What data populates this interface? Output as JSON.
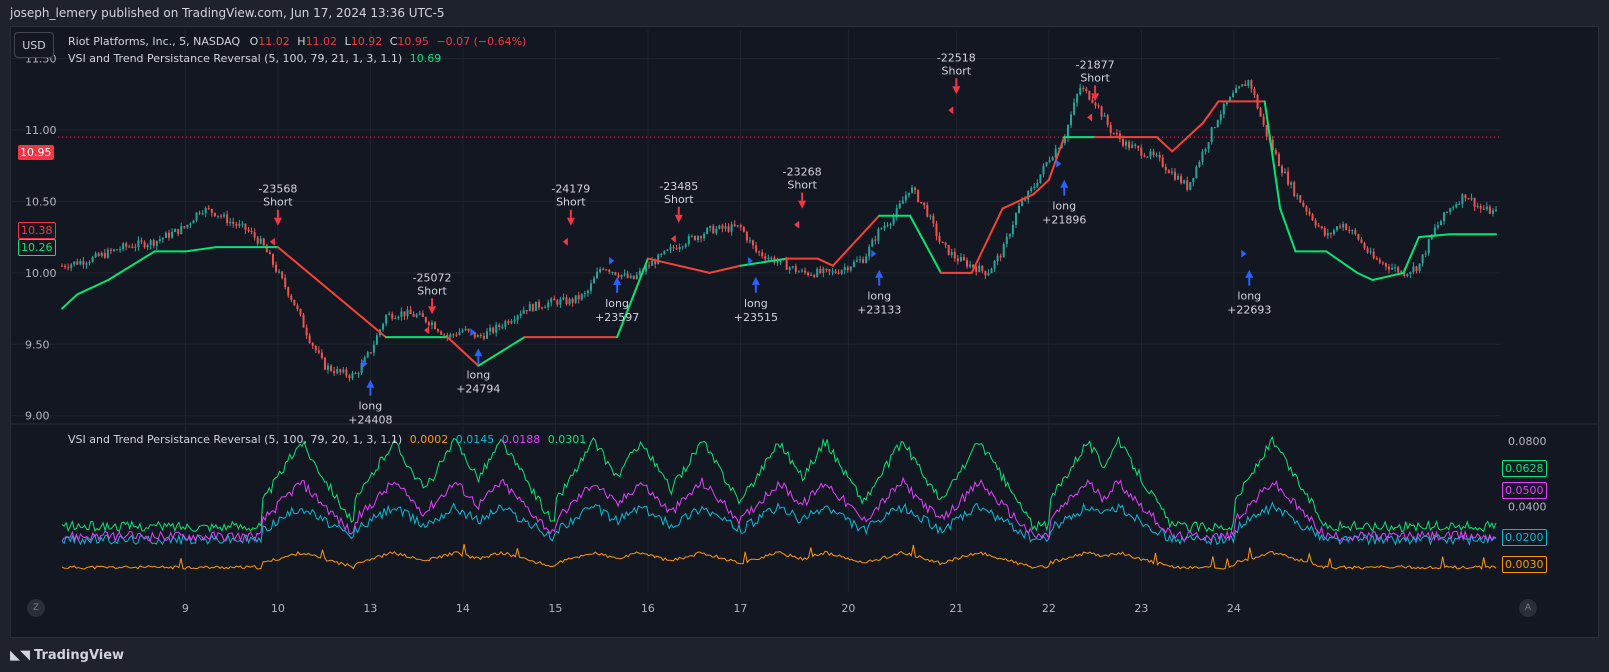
{
  "publish_line": "joseph_lemery published on TradingView.com, Jun 17, 2024 13:36 UTC-5",
  "currency_button": "USD",
  "symbol": {
    "name": "Riot Platforms, Inc., 5, NASDAQ",
    "o_label": "O",
    "o_value": "11.02",
    "h_label": "H",
    "h_value": "11.02",
    "l_label": "L",
    "l_value": "10.92",
    "c_label": "C",
    "c_value": "10.95",
    "change": "−0.07 (−0.64%)"
  },
  "indicator_main": {
    "label": "VSI and Trend Persistance Reversal (5, 100, 79, 21, 1, 3, 1.1)",
    "value": "10.69"
  },
  "indicator_sub": {
    "label": "VSI and Trend Persistance Reversal (5, 100, 79, 20, 1, 3, 1.1)",
    "v1": "0.0002",
    "v2": "0.0145",
    "v3": "0.0188",
    "v4": "0.0301"
  },
  "price_tags": {
    "last": "10.95",
    "upper": "10.38",
    "lower": "10.26"
  },
  "osc_tags": {
    "green": "0.0628",
    "magenta": "0.0500",
    "cyan": "0.0200",
    "orange": "0.0030"
  },
  "brand": "TradingView",
  "z_button": "Z",
  "a_button": "A",
  "colors": {
    "up": "#26a69a",
    "down": "#ef5350",
    "trend_up": "#00e676",
    "trend_down": "#f44336",
    "signal_long": "#2962ff",
    "signal_short": "#f23645",
    "orange": "#ff9800",
    "cyan": "#00bcd4",
    "magenta": "#e040fb",
    "green": "#00e676"
  },
  "chart_data": [
    {
      "type": "line",
      "title": "",
      "ylim": [
        8.97,
        11.7
      ],
      "y_ticks": [
        "11.50",
        "11.00",
        "10.50",
        "10.00",
        "9.50",
        "9.00"
      ],
      "x_ticks": [
        "9",
        "10",
        "13",
        "14",
        "15",
        "16",
        "17",
        "20",
        "21",
        "22",
        "23",
        "24"
      ],
      "last_price": 10.95,
      "series": [
        {
          "points": [
            [
              0,
              10.05
            ],
            [
              2,
              10.1
            ],
            [
              4,
              10.18
            ],
            [
              6,
              10.22
            ],
            [
              8,
              10.32
            ],
            [
              9,
              10.45
            ],
            [
              10,
              10.42
            ],
            [
              11,
              10.35
            ],
            [
              12,
              10.3
            ],
            [
              13,
              10.2
            ],
            [
              14,
              10.0
            ],
            [
              15,
              9.8
            ],
            [
              16,
              9.55
            ],
            [
              17,
              9.35
            ],
            [
              18,
              9.3
            ],
            [
              19,
              9.28
            ],
            [
              20,
              9.45
            ],
            [
              21,
              9.7
            ],
            [
              22,
              9.72
            ],
            [
              23,
              9.7
            ],
            [
              24,
              9.65
            ],
            [
              25,
              9.55
            ],
            [
              26,
              9.6
            ],
            [
              27,
              9.55
            ],
            [
              28,
              9.6
            ],
            [
              30,
              9.75
            ],
            [
              32,
              9.8
            ],
            [
              33,
              9.8
            ],
            [
              34,
              9.85
            ],
            [
              35,
              10.05
            ],
            [
              36,
              10.0
            ],
            [
              37,
              9.95
            ],
            [
              38,
              10.05
            ],
            [
              40,
              10.2
            ],
            [
              42,
              10.3
            ],
            [
              44,
              10.32
            ],
            [
              45,
              10.15
            ],
            [
              46,
              10.1
            ],
            [
              47,
              10.05
            ],
            [
              48,
              10.0
            ],
            [
              50,
              10.0
            ],
            [
              52,
              10.1
            ],
            [
              53,
              10.3
            ],
            [
              54,
              10.4
            ],
            [
              55,
              10.6
            ],
            [
              56,
              10.45
            ],
            [
              57,
              10.2
            ],
            [
              58,
              10.1
            ],
            [
              59,
              10.05
            ],
            [
              60,
              10.0
            ],
            [
              61,
              10.15
            ],
            [
              62,
              10.45
            ],
            [
              63,
              10.6
            ],
            [
              64,
              10.8
            ],
            [
              65,
              10.95
            ],
            [
              66,
              11.3
            ],
            [
              67,
              11.2
            ],
            [
              68,
              11.0
            ],
            [
              69,
              10.9
            ],
            [
              70,
              10.85
            ],
            [
              71,
              10.8
            ],
            [
              72,
              10.7
            ],
            [
              73,
              10.6
            ],
            [
              74,
              10.85
            ],
            [
              75,
              11.1
            ],
            [
              76,
              11.25
            ],
            [
              77,
              11.35
            ],
            [
              78,
              11.0
            ],
            [
              79,
              10.75
            ],
            [
              80,
              10.55
            ],
            [
              81,
              10.4
            ],
            [
              82,
              10.25
            ],
            [
              83,
              10.35
            ],
            [
              84,
              10.25
            ],
            [
              85,
              10.1
            ],
            [
              86,
              10.05
            ],
            [
              87,
              10.0
            ],
            [
              88,
              10.05
            ],
            [
              89,
              10.3
            ],
            [
              90,
              10.45
            ],
            [
              91,
              10.55
            ],
            [
              92,
              10.45
            ],
            [
              93,
              10.42
            ]
          ]
        },
        {
          "name": "",
          "points": [
            [
              0,
              9.75
            ],
            [
              1,
              9.85
            ],
            [
              3,
              9.95
            ],
            [
              6,
              10.15
            ],
            [
              8,
              10.15
            ],
            [
              10,
              10.18
            ],
            [
              14,
              10.18
            ],
            [
              21,
              9.55
            ],
            [
              25,
              9.55
            ],
            [
              27,
              9.35
            ],
            [
              30,
              9.55
            ],
            [
              36,
              9.55
            ],
            [
              38,
              10.1
            ],
            [
              42,
              10.0
            ],
            [
              44,
              10.05
            ],
            [
              47,
              10.1
            ],
            [
              49,
              10.1
            ],
            [
              50,
              10.05
            ],
            [
              53,
              10.4
            ],
            [
              55,
              10.4
            ],
            [
              57,
              10.0
            ],
            [
              59,
              10.0
            ],
            [
              61,
              10.45
            ],
            [
              63,
              10.55
            ],
            [
              64,
              10.65
            ],
            [
              65,
              10.95
            ],
            [
              67,
              10.95
            ],
            [
              71,
              10.95
            ],
            [
              72,
              10.85
            ],
            [
              73,
              10.95
            ],
            [
              74,
              11.05
            ],
            [
              75,
              11.2
            ],
            [
              78,
              11.2
            ],
            [
              79,
              10.45
            ],
            [
              80,
              10.15
            ],
            [
              82,
              10.15
            ],
            [
              84,
              10.0
            ],
            [
              85,
              9.95
            ],
            [
              87,
              10.0
            ],
            [
              88,
              10.25
            ],
            [
              90,
              10.27
            ],
            [
              93,
              10.27
            ]
          ]
        }
      ],
      "markers": [
        {
          "type": "short",
          "x": 14,
          "y": 10.33,
          "pnl": "-23568",
          "label": "Short"
        },
        {
          "type": "long",
          "x": 20,
          "y": 9.28,
          "pnl": "+24408",
          "label": "long"
        },
        {
          "type": "short",
          "x": 24,
          "y": 9.71,
          "pnl": "-25072",
          "label": "Short"
        },
        {
          "type": "long",
          "x": 27,
          "y": 9.5,
          "pnl": "+24794",
          "label": "long"
        },
        {
          "type": "short",
          "x": 33,
          "y": 10.33,
          "pnl": "-24179",
          "label": "Short"
        },
        {
          "type": "long",
          "x": 36,
          "y": 10.0,
          "pnl": "+23597",
          "label": "long"
        },
        {
          "type": "short",
          "x": 40,
          "y": 10.35,
          "pnl": "-23485",
          "label": "Short"
        },
        {
          "type": "long",
          "x": 45,
          "y": 10.0,
          "pnl": "+23515",
          "label": "long"
        },
        {
          "type": "short",
          "x": 48,
          "y": 10.45,
          "pnl": "-23268",
          "label": "Short"
        },
        {
          "type": "long",
          "x": 53,
          "y": 10.05,
          "pnl": "+23133",
          "label": "long"
        },
        {
          "type": "short",
          "x": 58,
          "y": 11.25,
          "pnl": "-22518",
          "label": "Short"
        },
        {
          "type": "long",
          "x": 65,
          "y": 10.68,
          "pnl": "+21896",
          "label": "long"
        },
        {
          "type": "short",
          "x": 67,
          "y": 11.2,
          "pnl": "-21877",
          "label": "Short"
        },
        {
          "type": "long",
          "x": 77,
          "y": 10.05,
          "pnl": "+22693",
          "label": "long"
        }
      ]
    },
    {
      "type": "line",
      "title": "",
      "ylim": [
        -0.012,
        0.088
      ],
      "y_ticks": [
        "0.0800",
        "0.0400"
      ],
      "series": [
        {
          "name": "",
          "base": 0.003,
          "peak": 0.012
        },
        {
          "name": "",
          "base": 0.02,
          "peak": 0.04
        },
        {
          "name": "",
          "base": 0.022,
          "peak": 0.055
        },
        {
          "name": "",
          "base": 0.028,
          "peak": 0.08
        }
      ]
    }
  ]
}
